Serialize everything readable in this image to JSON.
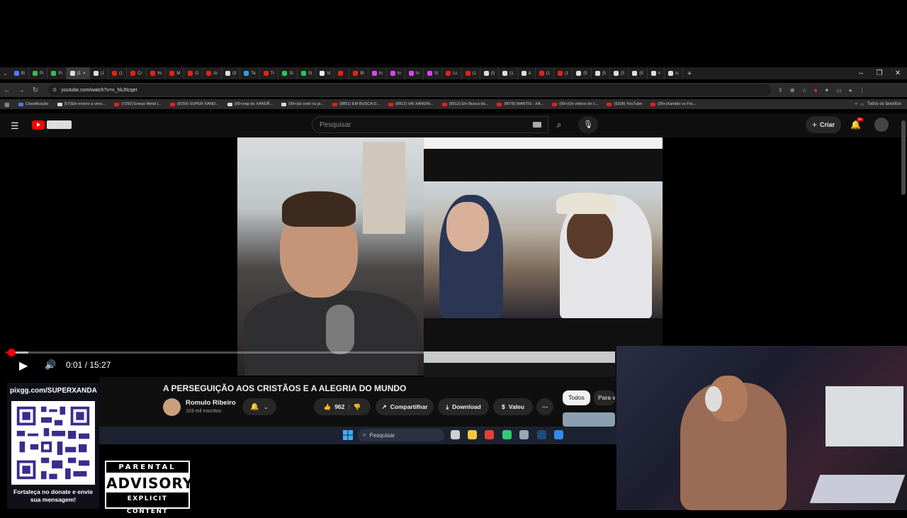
{
  "browser": {
    "tabs": [
      {
        "label": "Bi",
        "color": "#4f7cf7"
      },
      {
        "label": "Pi",
        "color": "#3fb950"
      },
      {
        "label": "Pi",
        "color": "#3fb950"
      },
      {
        "label": "(1",
        "color": "#ddd",
        "active": true
      },
      {
        "label": "(1",
        "color": "#ddd"
      },
      {
        "label": "(1",
        "color": "#e62117"
      },
      {
        "label": "Cr",
        "color": "#e62117"
      },
      {
        "label": "Yo",
        "color": "#e62117"
      },
      {
        "label": "M",
        "color": "#e62117"
      },
      {
        "label": "O",
        "color": "#e62117"
      },
      {
        "label": "Ar",
        "color": "#e62117"
      },
      {
        "label": "(9",
        "color": "#ddd"
      },
      {
        "label": "Te",
        "color": "#2aa3e0"
      },
      {
        "label": "Tr",
        "color": "#e62117"
      },
      {
        "label": "St",
        "color": "#22c55e"
      },
      {
        "label": "Sl",
        "color": "#22c55e"
      },
      {
        "label": "Vi",
        "color": "#eee"
      },
      {
        "label": "",
        "color": "#e62117"
      },
      {
        "label": "Bl",
        "color": "#e62117"
      },
      {
        "label": "In",
        "color": "#d946ef"
      },
      {
        "label": "In",
        "color": "#d946ef"
      },
      {
        "label": "In",
        "color": "#d946ef"
      },
      {
        "label": "Sl",
        "color": "#d946ef"
      },
      {
        "label": "Lc",
        "color": "#e62117"
      },
      {
        "label": "(1",
        "color": "#e62117"
      },
      {
        "label": "(5",
        "color": "#ddd"
      },
      {
        "label": "(1",
        "color": "#ddd"
      },
      {
        "label": "A",
        "color": "#ddd"
      },
      {
        "label": "(1",
        "color": "#e62117"
      },
      {
        "label": "(1",
        "color": "#e62117"
      },
      {
        "label": "(5",
        "color": "#ddd"
      },
      {
        "label": "(5",
        "color": "#ddd"
      },
      {
        "label": "(5",
        "color": "#ddd"
      },
      {
        "label": "(5",
        "color": "#ddd"
      },
      {
        "label": "#",
        "color": "#ddd"
      },
      {
        "label": "sı",
        "color": "#ddd"
      }
    ],
    "url": "youtube.com/watch?v=x_hkJtIcqeI",
    "bookmarks": [
      {
        "label": "Classificação",
        "color": "#4f7cf7"
      },
      {
        "label": "(57)Ele ensino a venc...",
        "color": "#ddd"
      },
      {
        "label": "(7292) Eneas Metal |...",
        "color": "#e62117"
      },
      {
        "label": "(8159) SUPER XAND...",
        "color": "#e62117"
      },
      {
        "label": "(99+)rap do XANDÃ...",
        "color": "#ddd"
      },
      {
        "label": "(99+)tá cedo ou já...",
        "color": "#ddd"
      },
      {
        "label": "(8851) EM BUSCA D...",
        "color": "#e62117"
      },
      {
        "label": "(8912) VAI XANDIN...",
        "color": "#e62117"
      },
      {
        "label": "(8912) Em Busca da...",
        "color": "#e62117"
      },
      {
        "label": "(9078) MANTIS - XA...",
        "color": "#e62117"
      },
      {
        "label": "(99+)Os vídeos de c...",
        "color": "#e62117"
      },
      {
        "label": "(9338) YouTube",
        "color": "#e62117"
      },
      {
        "label": "(99+)Xandão vs Fra...",
        "color": "#e62117"
      }
    ],
    "bookmarks_all": "Todos os favoritos"
  },
  "youtube": {
    "search_placeholder": "Pesquisar",
    "create_label": "Criar",
    "notif_count": "9+",
    "player": {
      "time": "0:01 / 15:27",
      "progress_fraction": 0.001
    },
    "video_title": "A PERSEGUIÇÃO AOS CRISTÃOS E A ALEGRIA DO MUNDO",
    "channel_name": "Romulo Ribeiro",
    "channel_subs": "103 mil inscritos",
    "like_count": "962",
    "share_label": "Compartilhar",
    "download_label": "Download",
    "thanks_label": "Valeu",
    "chips": {
      "all": "Todos",
      "para": "Para v"
    }
  },
  "taskbar": {
    "search_placeholder": "Pesquisar",
    "icons": [
      {
        "name": "task-view-icon",
        "color": "#d0d0d0"
      },
      {
        "name": "file-explorer-icon",
        "color": "#f5c542"
      },
      {
        "name": "chrome-icon",
        "color": "#e34133"
      },
      {
        "name": "app-icon",
        "color": "#2ecc71"
      },
      {
        "name": "settings-icon",
        "color": "#9aa4b2"
      },
      {
        "name": "steam-icon",
        "color": "#1b4d7a"
      },
      {
        "name": "app-blue-icon",
        "color": "#2d8cf0"
      }
    ]
  },
  "overlay": {
    "pix_url": "pixgg.com/SUPERXANDA",
    "pix_caption": "Fortaleça no donate e envie sua mensagem!",
    "advisory_top": "PARENTAL",
    "advisory_mid": "ADVISORY",
    "advisory_bottom": "EXPLICIT CONTENT"
  }
}
